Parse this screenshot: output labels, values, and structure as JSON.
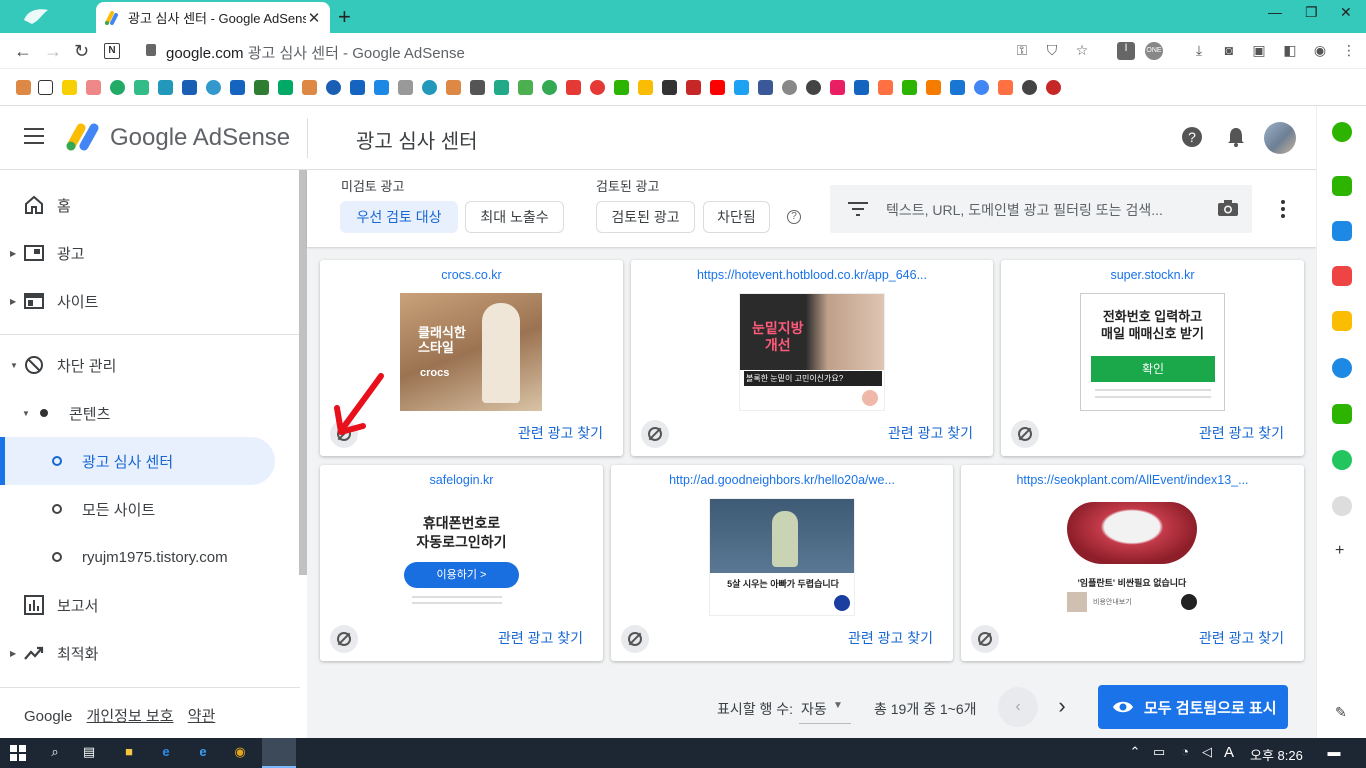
{
  "browser": {
    "tab_title": "광고 심사 센터 - Google AdSense",
    "tab_close": "✕",
    "new_tab": "+",
    "url_host": "google.com",
    "url_rest": "광고 심사 센터 - Google AdSense",
    "win_min": "—",
    "win_restore": "❐",
    "win_close": "✕"
  },
  "header": {
    "brand": "Google AdSense",
    "page_title": "광고 심사 센터"
  },
  "sidebar": {
    "items": [
      {
        "label": "홈",
        "icon": "home-icon"
      },
      {
        "label": "광고",
        "icon": "ads-icon"
      },
      {
        "label": "사이트",
        "icon": "sites-icon"
      },
      {
        "label": "차단 관리",
        "icon": "block-icon"
      },
      {
        "label": "콘텐츠",
        "icon": "dot-icon"
      },
      {
        "label": "광고 심사 센터",
        "icon": "circle-icon"
      },
      {
        "label": "모든 사이트",
        "icon": "circle-icon"
      },
      {
        "label": "ryujm1975.tistory.com",
        "icon": "circle-icon"
      },
      {
        "label": "보고서",
        "icon": "reports-icon"
      },
      {
        "label": "최적화",
        "icon": "optimize-icon"
      }
    ],
    "footer_brand": "Google",
    "privacy": "개인정보 보호",
    "terms": "약관"
  },
  "filters": {
    "group1_label": "미검토 광고",
    "chip_priority": "우선 검토 대상",
    "chip_max_impressions": "최대 노출수",
    "group2_label": "검토된 광고",
    "chip_reviewed": "검토된 광고",
    "chip_blocked": "차단됨",
    "help": "?",
    "search_placeholder": "텍스트, URL, 도메인별 광고 필터링 또는 검색..."
  },
  "cards": [
    {
      "domain": "crocs.co.kr",
      "find": "관련 광고 찾기",
      "ad_text_1": "클래식한",
      "ad_text_2": "스타일",
      "ad_brand": "crocs"
    },
    {
      "domain": "https://hotevent.hotblood.co.kr/app_646...",
      "find": "관련 광고 찾기",
      "ad_text_1": "눈밑지방",
      "ad_text_2": "개선",
      "ad_caption": "볼록한 눈밑이 고민이신가요?"
    },
    {
      "domain": "super.stockn.kr",
      "find": "관련 광고 찾기",
      "ad_text_1": "전화번호 입력하고",
      "ad_text_2": "매일 매매신호 받기",
      "ad_button": "확인"
    },
    {
      "domain": "safelogin.kr",
      "find": "관련 광고 찾기",
      "ad_text_1": "휴대폰번호로",
      "ad_text_2": "자동로그인하기",
      "ad_button": "이용하기 >"
    },
    {
      "domain": "http://ad.goodneighbors.kr/hello20a/we...",
      "find": "관련 광고 찾기",
      "ad_caption": "5살 시우는 아빠가 두렵습니다"
    },
    {
      "domain": "https://seokplant.com/AllEvent/index13_...",
      "find": "관련 광고 찾기",
      "ad_caption": "'임플란트' 비싼필요 없습니다",
      "ad_sub": "비용안내보기"
    }
  ],
  "pager": {
    "rows_label": "표시할 행 수:",
    "rows_value": "자동",
    "range": "총 19개 중 1~6개",
    "show_all": "모두 검토됨으로 표시"
  },
  "taskbar": {
    "ime": "A",
    "time": "오후 8:26"
  },
  "colors": {
    "accent": "#1a73e8",
    "tabstrip": "#35c9bb",
    "taskbar": "#1c2733"
  }
}
